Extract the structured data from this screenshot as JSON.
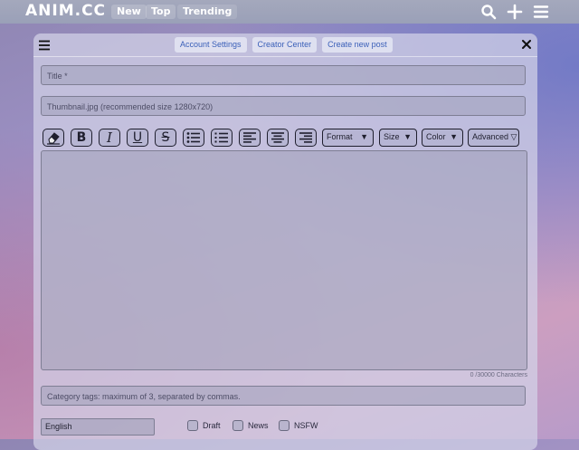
{
  "header": {
    "logo": "ANIM.CC",
    "nav": [
      "New",
      "Top",
      "Trending"
    ],
    "icons": [
      "search-icon",
      "plus-icon",
      "hamburger-menu-icon"
    ]
  },
  "panel": {
    "tabs": [
      "Account Settings",
      "Creator Center",
      "Create new post"
    ],
    "icons": [
      "hamburger-menu-icon",
      "close-icon"
    ]
  },
  "form": {
    "title_placeholder": "Title *",
    "thumbnail_placeholder": "Thumbnail.jpg (recommended size 1280x720)",
    "toolbar": {
      "buttons": [
        "eraser-icon",
        "bold-icon",
        "italic-icon",
        "underline-icon",
        "strikethrough-icon",
        "bulleted-list-icon",
        "numbered-list-icon",
        "align-left-icon",
        "align-center-icon",
        "align-right-icon"
      ],
      "bold_glyph": "B",
      "italic_glyph": "I",
      "underline_glyph": "U",
      "strike_glyph": "S",
      "format_label": "Format",
      "size_label": "Size",
      "color_label": "Color",
      "advanced_label": "Advanced ▽",
      "dropdown_arrow": "▼"
    },
    "char_count": "0 /30000 Characters",
    "tags_placeholder": "Category tags: maximum of 3, separated by commas.",
    "language": "English",
    "checkboxes": [
      {
        "label": "Draft",
        "checked": false
      },
      {
        "label": "News",
        "checked": false
      },
      {
        "label": "NSFW",
        "checked": false
      }
    ]
  }
}
